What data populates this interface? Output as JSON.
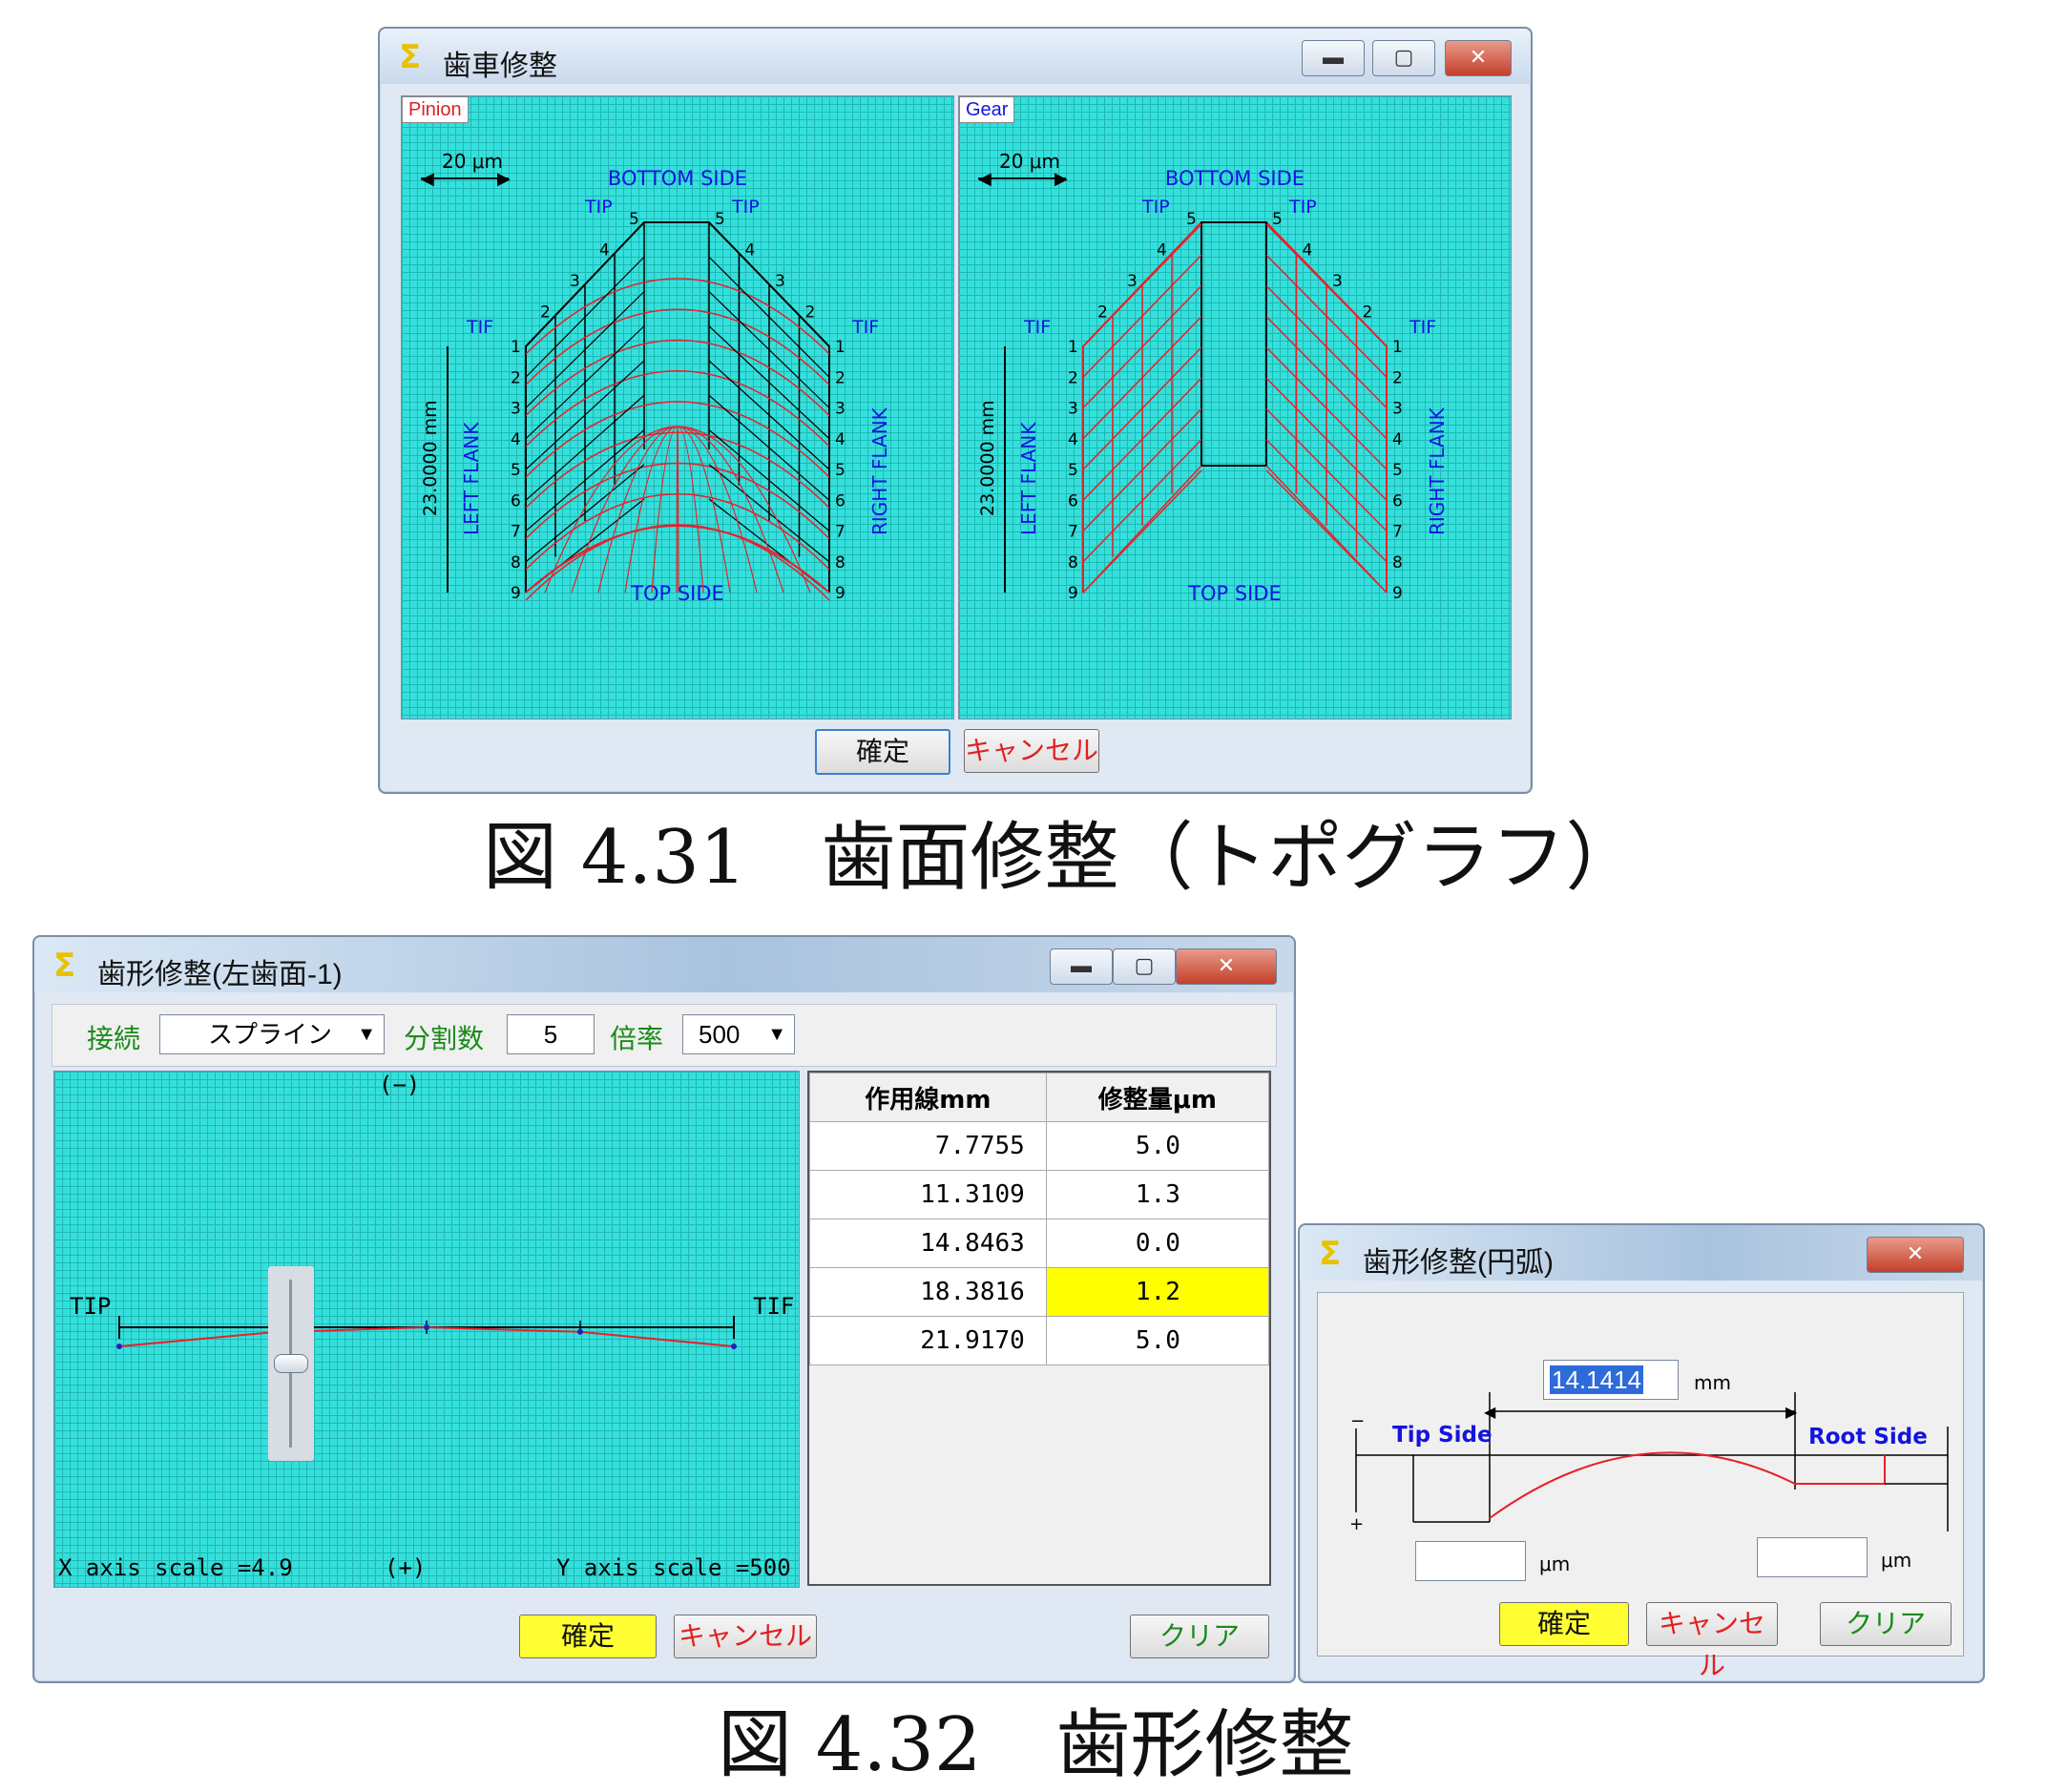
{
  "topo_window": {
    "title": "歯車修整",
    "ok_label": "確定",
    "cancel_label": "キャンセル",
    "panels": [
      {
        "tag": "Pinion",
        "scale": "20 μm",
        "length": "23.0000 mm",
        "bottom": "BOTTOM SIDE",
        "top": "TOP SIDE",
        "left": "LEFT FLANK",
        "right": "RIGHT FLANK",
        "tip": "TIP",
        "tif": "TIF"
      },
      {
        "tag": "Gear",
        "scale": "20 μm",
        "length": "23.0000 mm",
        "bottom": "BOTTOM SIDE",
        "top": "TOP SIDE",
        "left": "LEFT FLANK",
        "right": "RIGHT FLANK",
        "tip": "TIP",
        "tif": "TIF"
      }
    ],
    "side_numbers": [
      "1",
      "2",
      "3",
      "4",
      "5",
      "6",
      "7",
      "8",
      "9"
    ],
    "edge_numbers": [
      "5",
      "4",
      "3",
      "2"
    ]
  },
  "caption1": "図 4.31　歯面修整（トポグラフ）",
  "profile_window": {
    "title": "歯形修整(左歯面-1)",
    "connect_label": "接続",
    "connect_value": "スプライン",
    "divisions_label": "分割数",
    "divisions_value": "5",
    "ratio_label": "倍率",
    "ratio_value": "500",
    "minus_label": "(−)",
    "plus_label": "(+)",
    "tip_label": "TIP",
    "tif_label": "TIF",
    "x_scale": "X axis scale =4.9",
    "y_scale": "Y axis scale =500",
    "table_headers": [
      "作用線mm",
      "修整量μm"
    ],
    "table_rows": [
      {
        "pos": "7.7755",
        "amount": "5.0"
      },
      {
        "pos": "11.3109",
        "amount": "1.3"
      },
      {
        "pos": "14.8463",
        "amount": "0.0"
      },
      {
        "pos": "18.3816",
        "amount": "1.2"
      },
      {
        "pos": "21.9170",
        "amount": "5.0"
      }
    ],
    "ok_label": "確定",
    "cancel_label": "キャンセル",
    "clear_label": "クリア"
  },
  "arc_window": {
    "title": "歯形修整(円弧)",
    "width_value": "14.1414",
    "width_unit": "mm",
    "tip_side": "Tip Side",
    "root_side": "Root Side",
    "unit_um": "μm",
    "ok_label": "確定",
    "cancel_label": "キャンセル",
    "clear_label": "クリア"
  },
  "caption2": "図 4.32　歯形修整",
  "colors": {
    "grid_bg": "#35e0dc",
    "mesh_red": "#e8202a",
    "label_blue": "#1414e0",
    "highlight": "#ffff00"
  }
}
